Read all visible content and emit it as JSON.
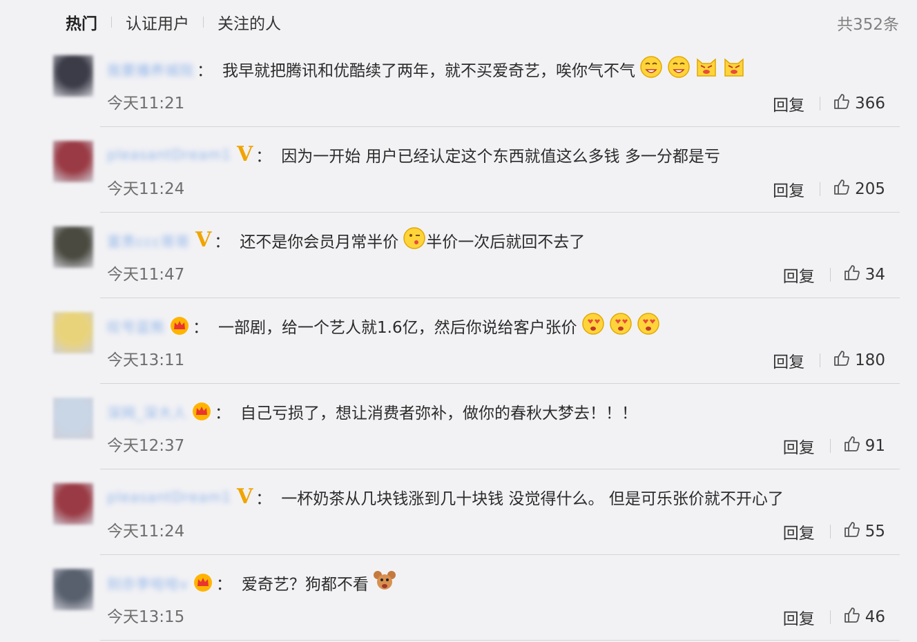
{
  "tabs": [
    "热门",
    "认证用户",
    "关注的人"
  ],
  "total_count": "共352条",
  "reply_label": "回复",
  "colon": "：",
  "comments": [
    {
      "username": "我要播养城院",
      "badge": "none",
      "text": "我早就把腾讯和优酷续了两年，就不买爱奇艺，唉你气不气",
      "emojis": [
        "grin-emoji",
        "grin-emoji",
        "cat-emoji",
        "cat-emoji"
      ],
      "time": "今天11:21",
      "likes": "366",
      "avatar_color": "#3c3c48"
    },
    {
      "username": "pleasantDream1",
      "badge": "v",
      "text": "因为一开始 用户已经认定这个东西就值这么多钱 多一分都是亏",
      "emojis": [],
      "time": "今天11:24",
      "likes": "205",
      "avatar_color": "#9a3a44"
    },
    {
      "username": "富贵ccc哥哥",
      "badge": "v",
      "text": "还不是你会员月常半价",
      "emojis": [
        "wink-emoji"
      ],
      "text_after": "半价一次后就回不去了",
      "time": "今天11:47",
      "likes": "34",
      "avatar_color": "#4a4a40"
    },
    {
      "username": "叹号蓝熊",
      "badge": "crown",
      "text": "一部剧，给一个艺人就1.6亿，然后你说给客户张价",
      "emojis": [
        "heart-eyes-emoji",
        "heart-eyes-emoji",
        "heart-eyes-emoji"
      ],
      "time": "今天13:11",
      "likes": "180",
      "avatar_color": "#e9d37a"
    },
    {
      "username": "深网_深大人",
      "badge": "crown",
      "text": "自己亏损了，想让消费者弥补，做你的春秋大梦去！！！",
      "emojis": [],
      "time": "今天12:37",
      "likes": "91",
      "avatar_color": "#c8d6e6"
    },
    {
      "username": "pleasantDream1",
      "badge": "v",
      "text": "一杯奶茶从几块钱涨到几十块钱 没觉得什么。 但是可乐张价就不开心了",
      "emojis": [],
      "time": "今天11:24",
      "likes": "55",
      "avatar_color": "#9a3a44"
    },
    {
      "username": "刻亦李哈哈v",
      "badge": "crown",
      "text": "爱奇艺？狗都不看",
      "emojis": [
        "jerry-emoji"
      ],
      "time": "今天13:15",
      "likes": "46",
      "avatar_color": "#58606e"
    }
  ]
}
